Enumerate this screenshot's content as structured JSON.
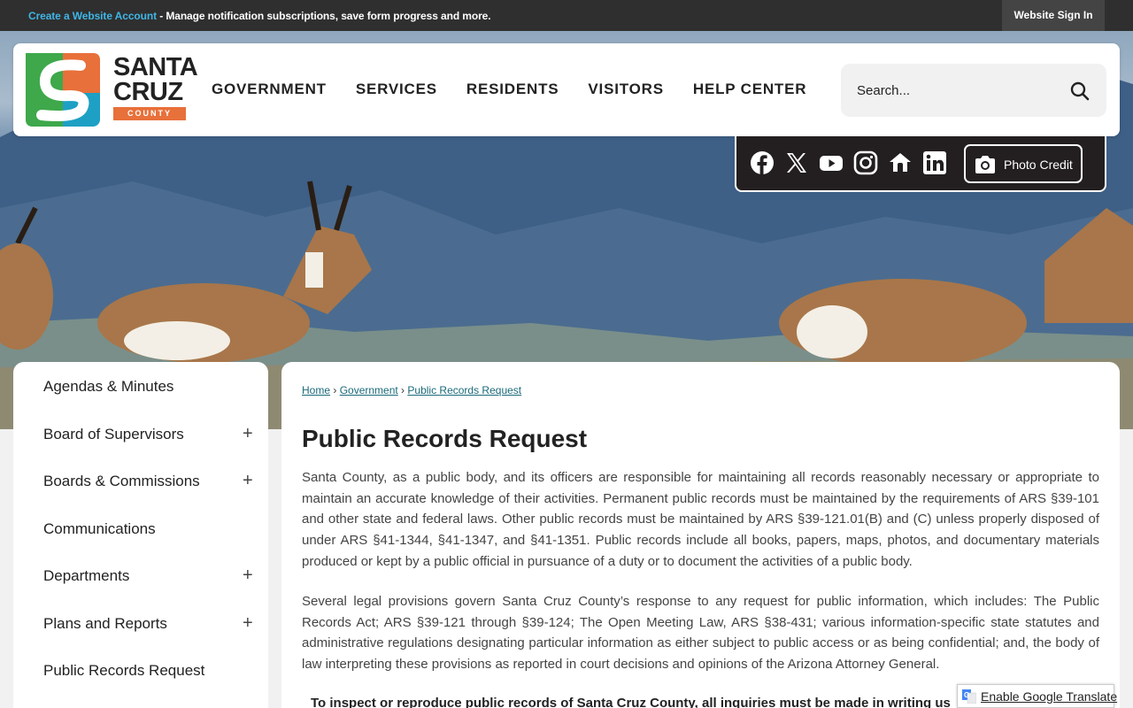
{
  "topbar": {
    "create_account_link": "Create a Website Account",
    "create_account_desc": " - Manage notification subscriptions, save form progress and more.",
    "sign_in": "Website Sign In"
  },
  "logo": {
    "line1": "SANTA",
    "line2": "CRUZ",
    "line3": "COUNTY"
  },
  "nav": [
    "GOVERNMENT",
    "SERVICES",
    "RESIDENTS",
    "VISITORS",
    "HELP CENTER"
  ],
  "search": {
    "placeholder": "Search..."
  },
  "social": {
    "icons": [
      "facebook-icon",
      "x-icon",
      "youtube-icon",
      "instagram-icon",
      "nextdoor-icon",
      "linkedin-icon"
    ],
    "photo_credit": "Photo Credit"
  },
  "sidebar": {
    "items": [
      {
        "label": "Agendas & Minutes",
        "expandable": false
      },
      {
        "label": "Board of Supervisors",
        "expandable": true
      },
      {
        "label": "Boards & Commissions",
        "expandable": true
      },
      {
        "label": "Communications",
        "expandable": false
      },
      {
        "label": "Departments",
        "expandable": true
      },
      {
        "label": "Plans and Reports",
        "expandable": true
      },
      {
        "label": "Public Records Request",
        "expandable": false
      }
    ],
    "plus_symbol": "+"
  },
  "breadcrumb": {
    "home": "Home",
    "sep": " › ",
    "government": "Government",
    "current": "Public Records Request"
  },
  "main": {
    "title": "Public Records Request",
    "paragraph1": "Santa County, as a public body, and its officers are responsible for maintaining all records reasonably necessary or appropriate to maintain an accurate knowledge of their activities. Permanent public records must be maintained by the requirements of ARS §39-101 and other state and federal laws.  Other public records must be maintained by ARS §39-121.01(B) and (C) unless properly disposed of under ARS §41-1344, §41-1347, and §41-1351. Public records include all books, papers, maps, photos, and documentary materials produced or kept by a public official in pursuance of a duty or to document the activities of a public body.",
    "paragraph2": "Several legal provisions govern Santa Cruz County’s response to any request for public information, which includes: The Public Records Act; ARS §39-121 through §39-124; The Open Meeting Law, ARS §38-431; various information-specific state statutes and administrative regulations designating particular information as either subject to public access or as being confidential; and, the body of law interpreting these provisions as reported in court decisions and opinions of the Arizona Attorney General.",
    "paragraph3": "To inspect or reproduce public records of Santa Cruz County, all inquiries must be made in writing us"
  },
  "translate": {
    "label": "Enable Google Translate"
  },
  "colors": {
    "topbar_bg": "#2f2f2f",
    "link_blue": "#3fb6e6",
    "logo_teal": "#1ea0c4",
    "logo_green": "#3ea84a",
    "logo_orange": "#e8703a",
    "social_bg": "#231f20",
    "crumb_link": "#1a6a7a"
  }
}
